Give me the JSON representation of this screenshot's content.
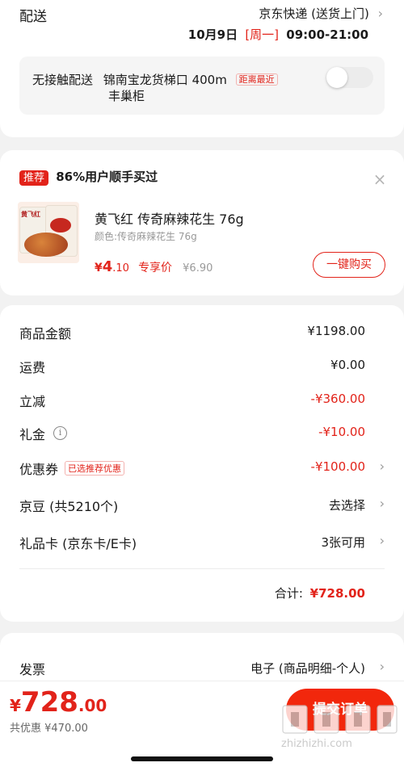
{
  "delivery": {
    "label": "配送",
    "method": "京东快递 (送货上门)",
    "date": "10月9日",
    "weekday": "[周一]",
    "time": "09:00-21:00",
    "contactless_title": "无接触配送",
    "location_line1": "锦南宝龙货梯口 400m",
    "location_line2": "丰巢柜",
    "nearest_tag": "距离最近",
    "toggle_on": false
  },
  "recommend": {
    "tag": "推荐",
    "title": "86%用户顺手买过",
    "product_name": "黄飞红 传奇麻辣花生 76g",
    "color_label": "颜色:传奇麻辣花生 76g",
    "price_symbol": "¥",
    "price_int": "4",
    "price_dec": ".10",
    "price_type": "专享价",
    "original_price": "¥6.90",
    "buy_button": "一键购买",
    "image_brand_text": "黄飞红"
  },
  "summary": {
    "rows": [
      {
        "label": "商品金额",
        "value": "¥1198.00"
      },
      {
        "label": "运费",
        "value": "¥0.00"
      },
      {
        "label": "立减",
        "value": "-¥360.00"
      },
      {
        "label": "礼金",
        "value": "-¥10.00"
      },
      {
        "label": "优惠券",
        "tag": "已选推荐优惠",
        "value": "-¥100.00"
      },
      {
        "label": "京豆 (共5210个)",
        "value": "去选择"
      },
      {
        "label": "礼品卡 (京东卡/E卡)",
        "value": "3张可用"
      }
    ],
    "total_label": "合计:",
    "total_value": "¥728.00"
  },
  "invoice": {
    "label": "发票",
    "value": "电子 (商品明细-个人)"
  },
  "bottom": {
    "currency": "¥",
    "amount_int": "728",
    "amount_dec": ".00",
    "savings": "共优惠 ¥470.00",
    "submit": "提交订单"
  },
  "watermark": "值 什么值得买 zhizhizhi.com",
  "colors": {
    "accent": "#e2231a",
    "background": "#f2f2f2",
    "card": "#ffffff"
  }
}
